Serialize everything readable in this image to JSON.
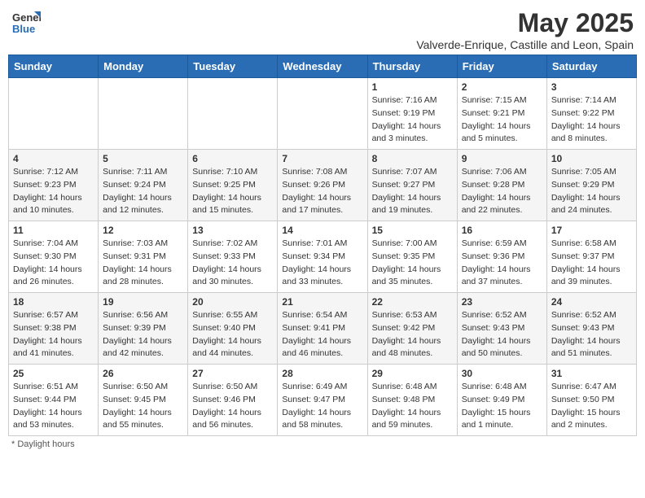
{
  "header": {
    "logo_general": "General",
    "logo_blue": "Blue",
    "month_title": "May 2025",
    "location": "Valverde-Enrique, Castille and Leon, Spain"
  },
  "weekdays": [
    "Sunday",
    "Monday",
    "Tuesday",
    "Wednesday",
    "Thursday",
    "Friday",
    "Saturday"
  ],
  "footer": {
    "note": "Daylight hours"
  },
  "weeks": [
    [
      {
        "day": "",
        "info": ""
      },
      {
        "day": "",
        "info": ""
      },
      {
        "day": "",
        "info": ""
      },
      {
        "day": "",
        "info": ""
      },
      {
        "day": "1",
        "info": "Sunrise: 7:16 AM\nSunset: 9:19 PM\nDaylight: 14 hours\nand 3 minutes."
      },
      {
        "day": "2",
        "info": "Sunrise: 7:15 AM\nSunset: 9:21 PM\nDaylight: 14 hours\nand 5 minutes."
      },
      {
        "day": "3",
        "info": "Sunrise: 7:14 AM\nSunset: 9:22 PM\nDaylight: 14 hours\nand 8 minutes."
      }
    ],
    [
      {
        "day": "4",
        "info": "Sunrise: 7:12 AM\nSunset: 9:23 PM\nDaylight: 14 hours\nand 10 minutes."
      },
      {
        "day": "5",
        "info": "Sunrise: 7:11 AM\nSunset: 9:24 PM\nDaylight: 14 hours\nand 12 minutes."
      },
      {
        "day": "6",
        "info": "Sunrise: 7:10 AM\nSunset: 9:25 PM\nDaylight: 14 hours\nand 15 minutes."
      },
      {
        "day": "7",
        "info": "Sunrise: 7:08 AM\nSunset: 9:26 PM\nDaylight: 14 hours\nand 17 minutes."
      },
      {
        "day": "8",
        "info": "Sunrise: 7:07 AM\nSunset: 9:27 PM\nDaylight: 14 hours\nand 19 minutes."
      },
      {
        "day": "9",
        "info": "Sunrise: 7:06 AM\nSunset: 9:28 PM\nDaylight: 14 hours\nand 22 minutes."
      },
      {
        "day": "10",
        "info": "Sunrise: 7:05 AM\nSunset: 9:29 PM\nDaylight: 14 hours\nand 24 minutes."
      }
    ],
    [
      {
        "day": "11",
        "info": "Sunrise: 7:04 AM\nSunset: 9:30 PM\nDaylight: 14 hours\nand 26 minutes."
      },
      {
        "day": "12",
        "info": "Sunrise: 7:03 AM\nSunset: 9:31 PM\nDaylight: 14 hours\nand 28 minutes."
      },
      {
        "day": "13",
        "info": "Sunrise: 7:02 AM\nSunset: 9:33 PM\nDaylight: 14 hours\nand 30 minutes."
      },
      {
        "day": "14",
        "info": "Sunrise: 7:01 AM\nSunset: 9:34 PM\nDaylight: 14 hours\nand 33 minutes."
      },
      {
        "day": "15",
        "info": "Sunrise: 7:00 AM\nSunset: 9:35 PM\nDaylight: 14 hours\nand 35 minutes."
      },
      {
        "day": "16",
        "info": "Sunrise: 6:59 AM\nSunset: 9:36 PM\nDaylight: 14 hours\nand 37 minutes."
      },
      {
        "day": "17",
        "info": "Sunrise: 6:58 AM\nSunset: 9:37 PM\nDaylight: 14 hours\nand 39 minutes."
      }
    ],
    [
      {
        "day": "18",
        "info": "Sunrise: 6:57 AM\nSunset: 9:38 PM\nDaylight: 14 hours\nand 41 minutes."
      },
      {
        "day": "19",
        "info": "Sunrise: 6:56 AM\nSunset: 9:39 PM\nDaylight: 14 hours\nand 42 minutes."
      },
      {
        "day": "20",
        "info": "Sunrise: 6:55 AM\nSunset: 9:40 PM\nDaylight: 14 hours\nand 44 minutes."
      },
      {
        "day": "21",
        "info": "Sunrise: 6:54 AM\nSunset: 9:41 PM\nDaylight: 14 hours\nand 46 minutes."
      },
      {
        "day": "22",
        "info": "Sunrise: 6:53 AM\nSunset: 9:42 PM\nDaylight: 14 hours\nand 48 minutes."
      },
      {
        "day": "23",
        "info": "Sunrise: 6:52 AM\nSunset: 9:43 PM\nDaylight: 14 hours\nand 50 minutes."
      },
      {
        "day": "24",
        "info": "Sunrise: 6:52 AM\nSunset: 9:43 PM\nDaylight: 14 hours\nand 51 minutes."
      }
    ],
    [
      {
        "day": "25",
        "info": "Sunrise: 6:51 AM\nSunset: 9:44 PM\nDaylight: 14 hours\nand 53 minutes."
      },
      {
        "day": "26",
        "info": "Sunrise: 6:50 AM\nSunset: 9:45 PM\nDaylight: 14 hours\nand 55 minutes."
      },
      {
        "day": "27",
        "info": "Sunrise: 6:50 AM\nSunset: 9:46 PM\nDaylight: 14 hours\nand 56 minutes."
      },
      {
        "day": "28",
        "info": "Sunrise: 6:49 AM\nSunset: 9:47 PM\nDaylight: 14 hours\nand 58 minutes."
      },
      {
        "day": "29",
        "info": "Sunrise: 6:48 AM\nSunset: 9:48 PM\nDaylight: 14 hours\nand 59 minutes."
      },
      {
        "day": "30",
        "info": "Sunrise: 6:48 AM\nSunset: 9:49 PM\nDaylight: 15 hours\nand 1 minute."
      },
      {
        "day": "31",
        "info": "Sunrise: 6:47 AM\nSunset: 9:50 PM\nDaylight: 15 hours\nand 2 minutes."
      }
    ]
  ]
}
